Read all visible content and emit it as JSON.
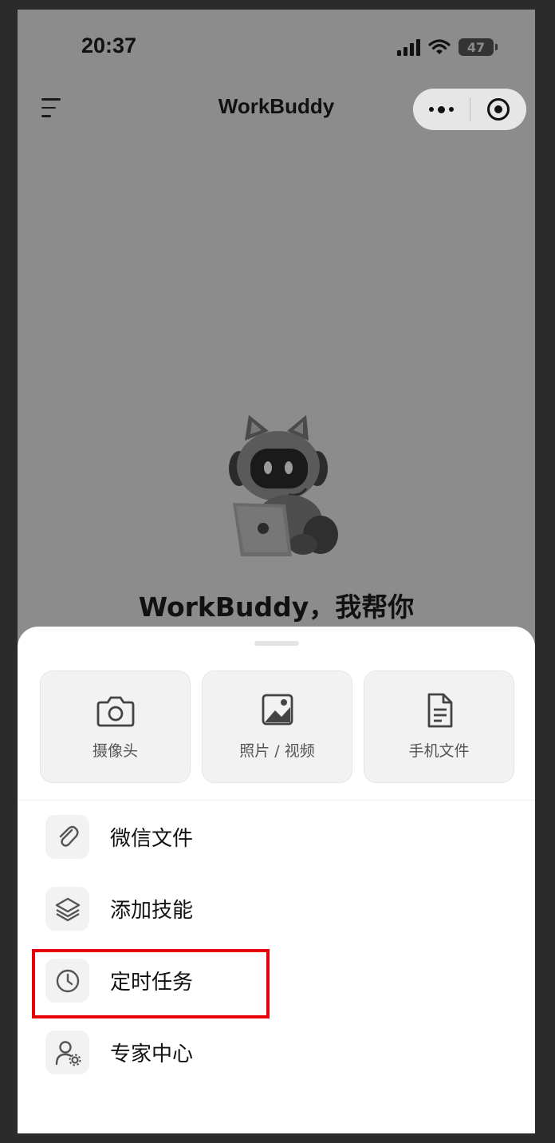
{
  "status_bar": {
    "time": "20:37",
    "battery": "47"
  },
  "nav": {
    "title": "WorkBuddy",
    "menu_icon": "hamburger-menu-icon",
    "more_icon": "more-dots-icon",
    "close_icon": "target-circle-icon"
  },
  "hero": {
    "title": "WorkBuddy，我帮你"
  },
  "sheet": {
    "tiles": [
      {
        "label": "摄像头",
        "icon": "camera-icon"
      },
      {
        "label": "照片 / 视频",
        "icon": "image-icon"
      },
      {
        "label": "手机文件",
        "icon": "document-icon"
      }
    ],
    "items": [
      {
        "label": "微信文件",
        "icon": "paperclip-icon"
      },
      {
        "label": "添加技能",
        "icon": "layers-icon"
      },
      {
        "label": "定时任务",
        "icon": "clock-icon"
      },
      {
        "label": "专家中心",
        "icon": "user-gear-icon"
      }
    ]
  },
  "colors": {
    "highlight": "#e8000b",
    "backdrop": "#8c8c8c",
    "sheet": "#ffffff"
  }
}
